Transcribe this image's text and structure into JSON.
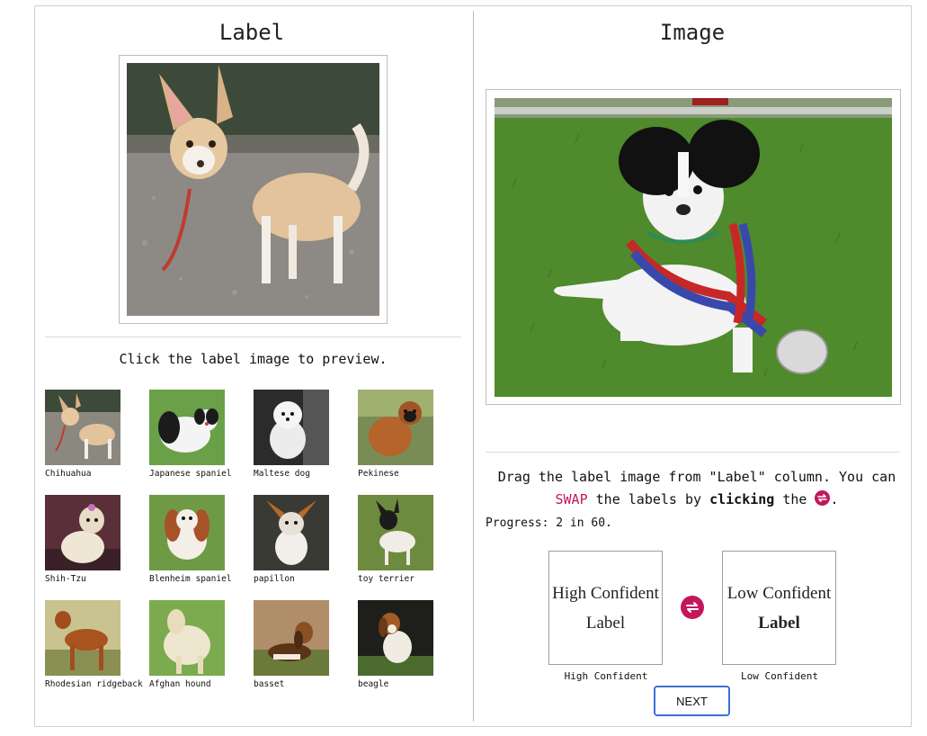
{
  "left_column": {
    "title": "Label",
    "preview_hint": "Click the label image to preview.",
    "thumbnails": [
      {
        "caption": "Chihuahua"
      },
      {
        "caption": "Japanese spaniel"
      },
      {
        "caption": "Maltese dog"
      },
      {
        "caption": "Pekinese"
      },
      {
        "caption": "Shih-Tzu"
      },
      {
        "caption": "Blenheim spaniel"
      },
      {
        "caption": "papillon"
      },
      {
        "caption": "toy terrier"
      },
      {
        "caption": "Rhodesian ridgeback"
      },
      {
        "caption": "Afghan hound"
      },
      {
        "caption": "basset"
      },
      {
        "caption": "beagle"
      }
    ]
  },
  "right_column": {
    "title": "Image",
    "instruction_part1": "Drag the label image from \"Label\" column. You can ",
    "swap_word": "SWAP",
    "instruction_part2": " the labels by ",
    "clicking_word": "clicking",
    "instruction_part3": " the ",
    "instruction_end": ".",
    "progress": "Progress: 2 in 60.",
    "high_box_line1": "High Confident",
    "high_box_line2": "Label",
    "low_box_line1": "Low Confident",
    "low_box_line2": "Label",
    "high_caption": "High Confident",
    "low_caption": "Low Confident",
    "next_label": "NEXT"
  },
  "colors": {
    "swap_accent": "#c2185b",
    "next_border": "#3b6fd6"
  }
}
